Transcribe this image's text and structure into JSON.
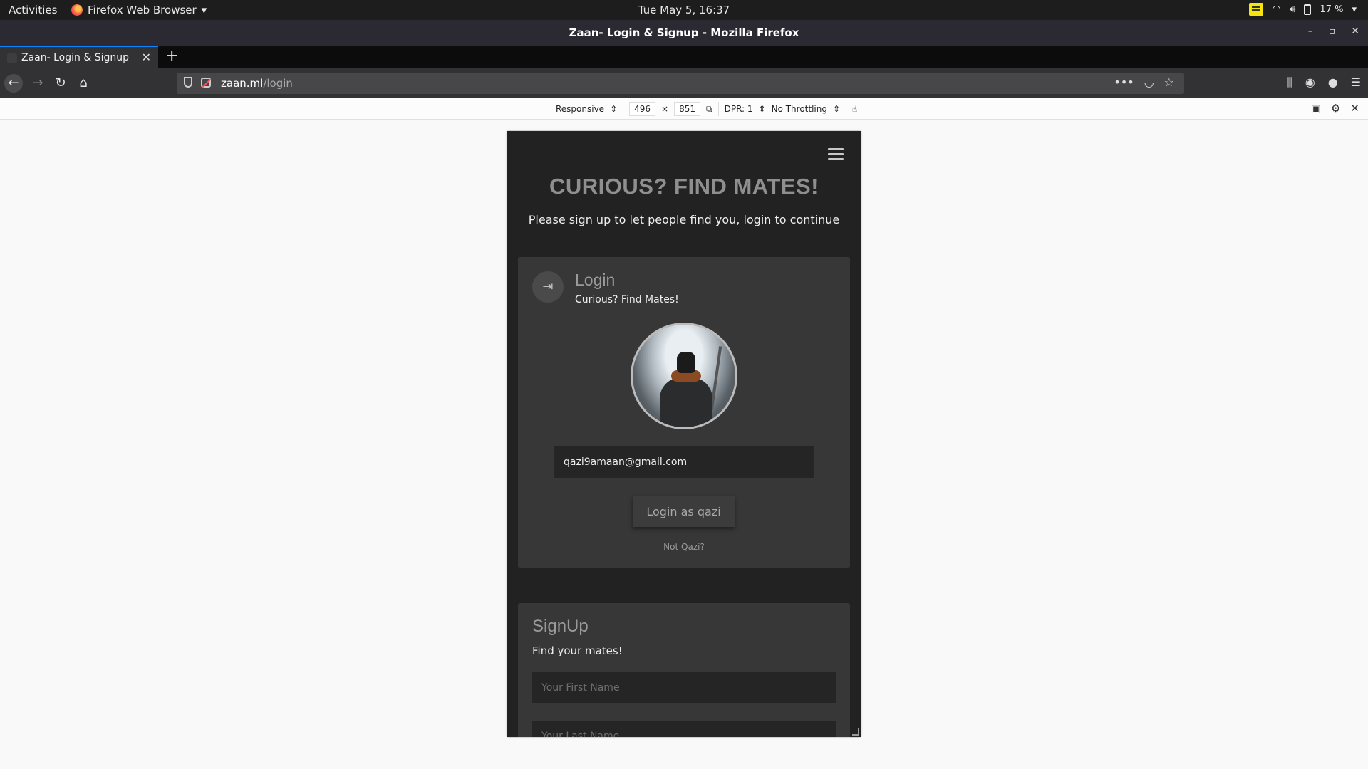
{
  "system": {
    "activities": "Activities",
    "app_menu": "Firefox Web Browser",
    "clock": "Tue May  5, 16:37",
    "battery": "17 %"
  },
  "window": {
    "title": "Zaan- Login & Signup - Mozilla Firefox"
  },
  "tabs": [
    {
      "label": "Zaan- Login & Signup",
      "active": true
    }
  ],
  "address_bar": {
    "domain": "zaan.ml",
    "path": "/login"
  },
  "rdm": {
    "device": "Responsive",
    "width": "496",
    "times": "×",
    "height": "851",
    "dpr": "DPR: 1",
    "throttling": "No Throttling"
  },
  "page": {
    "hero_title": "CURIOUS? FIND MATES!",
    "hero_subtitle": "Please sign up to let people find you, login to continue",
    "login": {
      "title": "Login",
      "subtitle": "Curious? Find Mates!",
      "email_value": "qazi9amaan@gmail.com",
      "button": "Login as qazi",
      "not_user": "Not Qazi?"
    },
    "signup": {
      "title": "SignUp",
      "subtitle": "Find your mates!",
      "first_name_placeholder": "Your First Name",
      "last_name_placeholder": "Your Last Name"
    }
  },
  "colors": {
    "page_bg": "#222222",
    "card_bg": "#373737",
    "input_bg": "#252525",
    "accent_tab": "#0a84ff"
  }
}
